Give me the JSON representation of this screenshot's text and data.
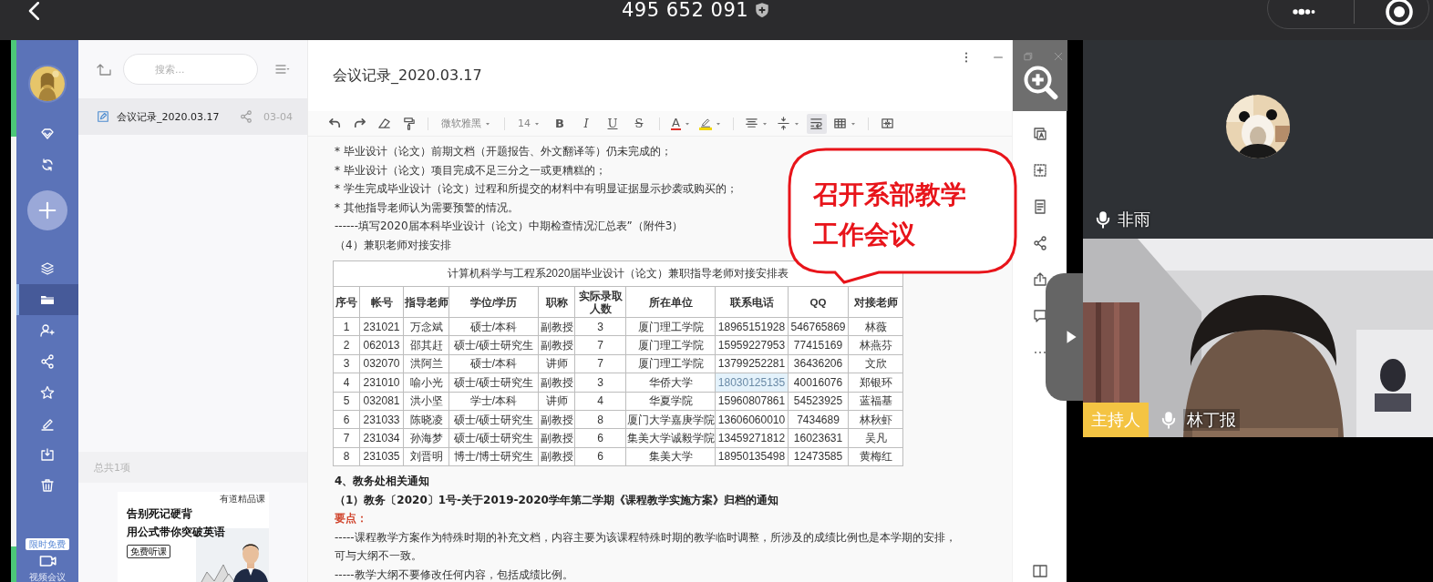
{
  "call_bar": {
    "meeting_id": "495 652 091"
  },
  "sidebar": {
    "items": [
      {
        "kind": "diamond",
        "selected": false
      },
      {
        "kind": "sync",
        "selected": false
      },
      {
        "kind": "add",
        "selected": false
      },
      {
        "kind": "layers",
        "selected": false
      },
      {
        "kind": "folder",
        "selected": true
      },
      {
        "kind": "contacts",
        "selected": false
      },
      {
        "kind": "share",
        "selected": false
      },
      {
        "kind": "star",
        "selected": false
      },
      {
        "kind": "pen",
        "selected": false
      },
      {
        "kind": "import",
        "selected": false
      },
      {
        "kind": "trash",
        "selected": false
      }
    ],
    "promo_badge": "限时免费",
    "meeting_label": "视频会议"
  },
  "file_list": {
    "search": {
      "placeholder": "搜索..."
    },
    "files": [
      {
        "name": "会议记录_2020.03.17",
        "date": "03-04",
        "selected": true
      }
    ],
    "count": "总共1项",
    "ad": {
      "headlines": [
        "告别死记硬背",
        "用公式带你突破英语"
      ],
      "button": "免费听课",
      "brand": "有道精品课"
    }
  },
  "editor": {
    "title": "会议记录_2020.03.17",
    "toolbar": [
      {
        "kind": "undo",
        "on": false
      },
      {
        "kind": "redo",
        "on": false
      },
      {
        "kind": "eraser",
        "on": false
      },
      {
        "kind": "painter",
        "on": false
      },
      {
        "kind": "separator"
      },
      {
        "kind": "dropdown",
        "label": "微软雅黑",
        "on": false
      },
      {
        "kind": "separator"
      },
      {
        "kind": "dropdown",
        "label": "14",
        "on": false
      },
      {
        "kind": "bold",
        "label": "B",
        "on": false
      },
      {
        "kind": "italic",
        "label": "I",
        "on": false
      },
      {
        "kind": "underline",
        "label": "U",
        "on": false
      },
      {
        "kind": "strike",
        "label": "S",
        "on": false
      },
      {
        "kind": "separator"
      },
      {
        "kind": "font-color",
        "label": "A",
        "color": "#e0302a",
        "on": false
      },
      {
        "kind": "highlight",
        "color": "#f2d600",
        "on": false
      },
      {
        "kind": "separator"
      },
      {
        "kind": "align",
        "on": false
      },
      {
        "kind": "line-height",
        "on": false
      },
      {
        "kind": "wrap",
        "on": true
      },
      {
        "kind": "table",
        "on": false
      },
      {
        "kind": "separator"
      },
      {
        "kind": "merge",
        "on": false
      }
    ],
    "paragraphs": [
      {
        "kind": "normal",
        "text": "* 毕业设计（论文）前期文档（开题报告、外文翻译等）仍未完成的；"
      },
      {
        "kind": "normal",
        "text": "* 毕业设计（论文）项目完成不足三分之一或更糟糕的；"
      },
      {
        "kind": "normal",
        "text": "* 学生完成毕业设计（论文）过程和所提交的材料中有明显证据显示抄袭或购买的；"
      },
      {
        "kind": "normal",
        "text": "* 其他指导老师认为需要预警的情况。"
      },
      {
        "kind": "normal",
        "text": "------填写2020届本科毕业设计（论文）中期检查情况汇总表”（附件3）"
      },
      {
        "kind": "normal",
        "text": " （4）兼职老师对接安排"
      }
    ],
    "table": {
      "title": "计算机科学与工程系2020届毕业设计（论文）兼职指导老师对接安排表",
      "columns": [
        "序号",
        "帐号",
        "指导老师",
        "学位/学历",
        "职称",
        "实际录取人数",
        "所在单位",
        "联系电话",
        "QQ",
        "对接老师"
      ],
      "rows": [
        {
          "cells": [
            {
              "text": "1",
              "selected": false
            },
            {
              "text": "231021",
              "selected": false
            },
            {
              "text": "万念斌",
              "selected": false
            },
            {
              "text": "硕士/本科",
              "selected": false
            },
            {
              "text": "副教授",
              "selected": false
            },
            {
              "text": "3",
              "selected": false
            },
            {
              "text": "厦门理工学院",
              "selected": false
            },
            {
              "text": "18965151928",
              "selected": false
            },
            {
              "text": "546765869",
              "selected": false
            },
            {
              "text": "林薇",
              "selected": false
            }
          ]
        },
        {
          "cells": [
            {
              "text": "2",
              "selected": false
            },
            {
              "text": "062013",
              "selected": false
            },
            {
              "text": "邵其赶",
              "selected": false
            },
            {
              "text": "硕士/硕士研究生",
              "selected": false
            },
            {
              "text": "副教授",
              "selected": false
            },
            {
              "text": "7",
              "selected": false
            },
            {
              "text": "厦门理工学院",
              "selected": false
            },
            {
              "text": "15959227953",
              "selected": false
            },
            {
              "text": "77415169",
              "selected": false
            },
            {
              "text": "林燕芬",
              "selected": false
            }
          ]
        },
        {
          "cells": [
            {
              "text": "3",
              "selected": false
            },
            {
              "text": "032070",
              "selected": false
            },
            {
              "text": "洪阿兰",
              "selected": false
            },
            {
              "text": "硕士/本科",
              "selected": false
            },
            {
              "text": "讲师",
              "selected": false
            },
            {
              "text": "7",
              "selected": false
            },
            {
              "text": "厦门理工学院",
              "selected": false
            },
            {
              "text": "13799252281",
              "selected": false
            },
            {
              "text": "36436206",
              "selected": false
            },
            {
              "text": "文欣",
              "selected": false
            }
          ]
        },
        {
          "cells": [
            {
              "text": "4",
              "selected": false
            },
            {
              "text": "231010",
              "selected": false
            },
            {
              "text": "喻小光",
              "selected": false
            },
            {
              "text": "硕士/硕士研究生",
              "selected": false
            },
            {
              "text": "副教授",
              "selected": false
            },
            {
              "text": "3",
              "selected": false
            },
            {
              "text": "华侨大学",
              "selected": false
            },
            {
              "text": "18030125135",
              "selected": true
            },
            {
              "text": "40016076",
              "selected": false
            },
            {
              "text": "郑银环",
              "selected": false
            }
          ]
        },
        {
          "cells": [
            {
              "text": "5",
              "selected": false
            },
            {
              "text": "032081",
              "selected": false
            },
            {
              "text": "洪小坚",
              "selected": false
            },
            {
              "text": "学士/本科",
              "selected": false
            },
            {
              "text": "讲师",
              "selected": false
            },
            {
              "text": "4",
              "selected": false
            },
            {
              "text": "华夏学院",
              "selected": false
            },
            {
              "text": "15960807861",
              "selected": false
            },
            {
              "text": "54523925",
              "selected": false
            },
            {
              "text": "蓝福基",
              "selected": false
            }
          ]
        },
        {
          "cells": [
            {
              "text": "6",
              "selected": false
            },
            {
              "text": "231033",
              "selected": false
            },
            {
              "text": "陈晓凌",
              "selected": false
            },
            {
              "text": "硕士/硕士研究生",
              "selected": false
            },
            {
              "text": "副教授",
              "selected": false
            },
            {
              "text": "8",
              "selected": false
            },
            {
              "text": "厦门大学嘉庚学院",
              "selected": false
            },
            {
              "text": "13606060010",
              "selected": false
            },
            {
              "text": "7434689",
              "selected": false
            },
            {
              "text": "林秋虾",
              "selected": false
            }
          ]
        },
        {
          "cells": [
            {
              "text": "7",
              "selected": false
            },
            {
              "text": "231034",
              "selected": false
            },
            {
              "text": "孙海梦",
              "selected": false
            },
            {
              "text": "硕士/硕士研究生",
              "selected": false
            },
            {
              "text": "副教授",
              "selected": false
            },
            {
              "text": "6",
              "selected": false
            },
            {
              "text": "集美大学诚毅学院",
              "selected": false
            },
            {
              "text": "13459271812",
              "selected": false
            },
            {
              "text": "16023631",
              "selected": false
            },
            {
              "text": "吴凡",
              "selected": false
            }
          ]
        },
        {
          "cells": [
            {
              "text": "8",
              "selected": false
            },
            {
              "text": "231035",
              "selected": false
            },
            {
              "text": "刘晋明",
              "selected": false
            },
            {
              "text": "博士/博士研究生",
              "selected": false
            },
            {
              "text": "副教授",
              "selected": false
            },
            {
              "text": "6",
              "selected": false
            },
            {
              "text": "集美大学",
              "selected": false
            },
            {
              "text": "18950135498",
              "selected": false
            },
            {
              "text": "12473585",
              "selected": false
            },
            {
              "text": "黄梅红",
              "selected": false
            }
          ]
        }
      ]
    },
    "paragraphs_after": [
      {
        "kind": "heading",
        "text": "4、教务处相关通知"
      },
      {
        "kind": "heading",
        "text": "（1）教务〔2020〕1号-关于2019-2020学年第二学期《课程教学实施方案》归档的通知"
      },
      {
        "kind": "emphasis",
        "text": "要点："
      },
      {
        "kind": "normal",
        "text": "-----课程教学方案作为特殊时期的补充文档，内容主要为该课程特殊时期的教学临时调整，所涉及的成绩比例也是本学期的安排，可与大纲不一致。"
      },
      {
        "kind": "normal",
        "text": "-----教学大纲不要修改任何内容，包括成绩比例。"
      }
    ]
  },
  "side_tools": [
    {
      "kind": "text-box"
    },
    {
      "kind": "add-box"
    },
    {
      "kind": "document"
    },
    {
      "kind": "share"
    },
    {
      "kind": "export"
    },
    {
      "kind": "comment"
    },
    {
      "kind": "more"
    }
  ],
  "annotation": {
    "lines": [
      "召开系部教学",
      "工作会议"
    ]
  },
  "participants": [
    {
      "name": "非雨",
      "video": false
    },
    {
      "name": "林丁报",
      "role": "主持人",
      "video": true
    }
  ]
}
